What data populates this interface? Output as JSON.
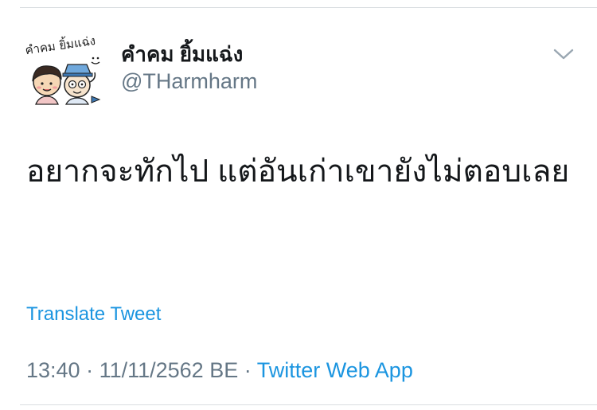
{
  "tweet": {
    "author": {
      "display_name": "คำคม ยิ้มแฉ่ง",
      "handle": "@THarmharm",
      "avatar_text": "คำคม ยิ้มแฉ่ง",
      "avatar_icon": "cartoon-avatar-icon"
    },
    "menu_icon": "chevron-down-icon",
    "text": "อยากจะทักไป แต่อันเก่าเขายังไม่ตอบเลย",
    "translate_label": "Translate Tweet",
    "time": "13:40",
    "separator": " · ",
    "date": "11/11/2562 BE",
    "source": "Twitter Web App"
  },
  "colors": {
    "link": "#1b95e0",
    "secondary_text": "#657786",
    "primary_text": "#14171a",
    "divider": "#d9dde1"
  }
}
